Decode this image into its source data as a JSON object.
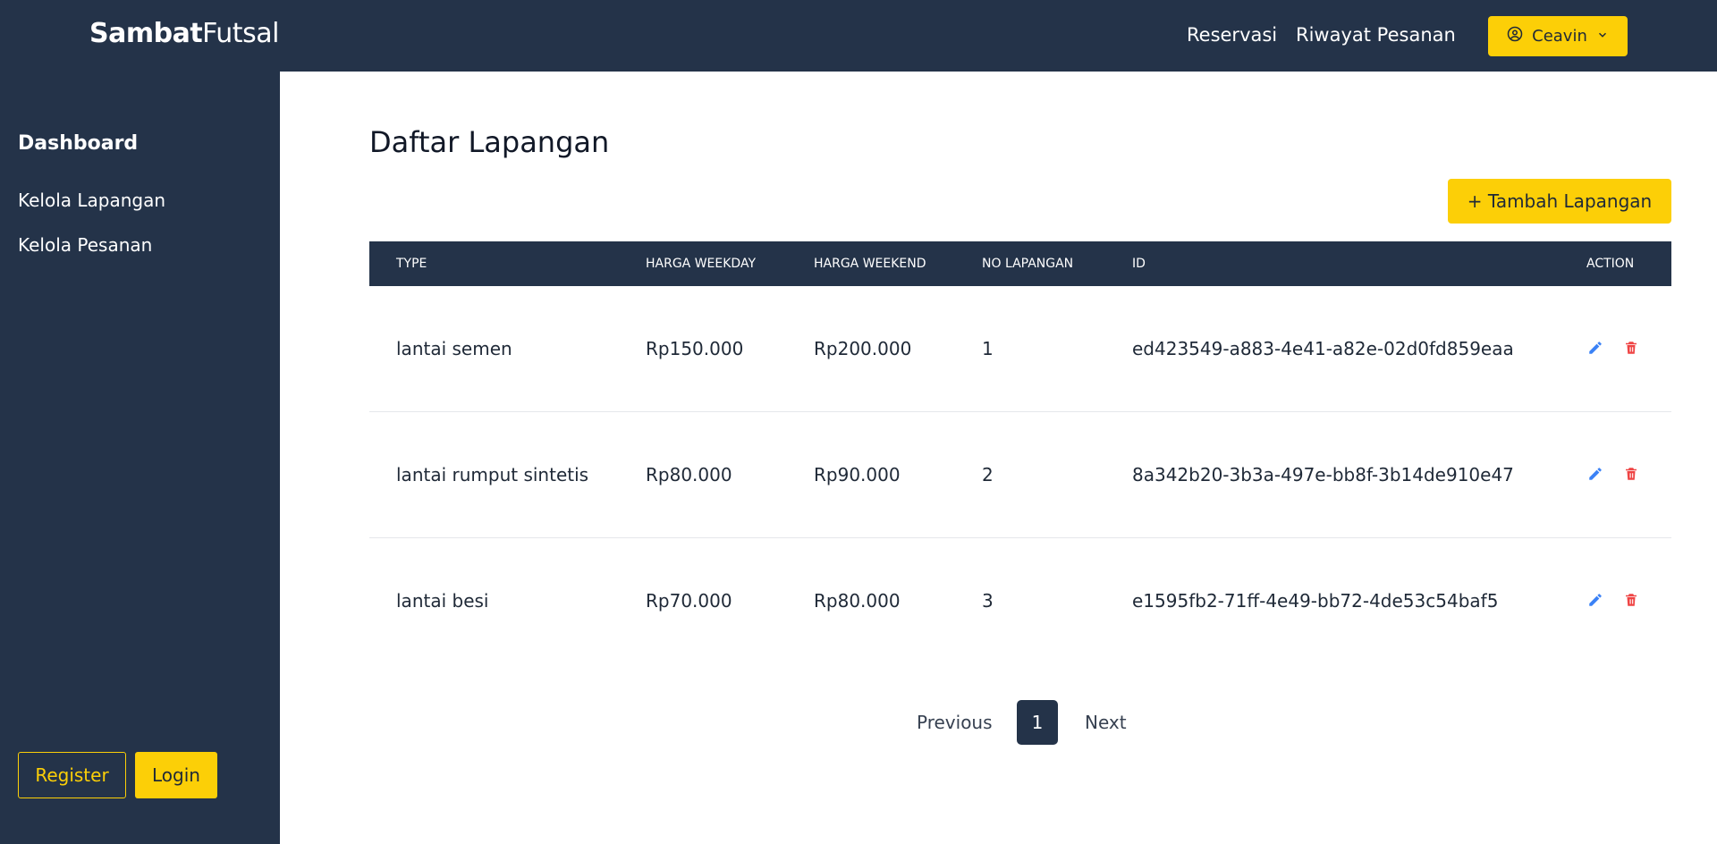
{
  "brand": {
    "bold": "Sambat",
    "light": "Futsal"
  },
  "topnav": {
    "reservasi": "Reservasi",
    "riwayat": "Riwayat Pesanan",
    "user": "Ceavin"
  },
  "sidebar": {
    "title": "Dashboard",
    "items": [
      {
        "label": "Kelola Lapangan"
      },
      {
        "label": "Kelola Pesanan"
      }
    ],
    "register": "Register",
    "login": "Login"
  },
  "main": {
    "title": "Daftar Lapangan",
    "add_button": "+ Tambah Lapangan"
  },
  "table": {
    "headers": [
      "TYPE",
      "HARGA WEEKDAY",
      "HARGA WEEKEND",
      "NO LAPANGAN",
      "ID",
      "ACTION"
    ],
    "rows": [
      {
        "type": "lantai semen",
        "weekday": "Rp150.000",
        "weekend": "Rp200.000",
        "no": "1",
        "id": "ed423549-a883-4e41-a82e-02d0fd859eaa"
      },
      {
        "type": "lantai rumput sintetis",
        "weekday": "Rp80.000",
        "weekend": "Rp90.000",
        "no": "2",
        "id": "8a342b20-3b3a-497e-bb8f-3b14de910e47"
      },
      {
        "type": "lantai besi",
        "weekday": "Rp70.000",
        "weekend": "Rp80.000",
        "no": "3",
        "id": "e1595fb2-71ff-4e49-bb72-4de53c54baf5"
      }
    ]
  },
  "pagination": {
    "previous": "Previous",
    "current": "1",
    "next": "Next"
  },
  "colors": {
    "navy": "#243349",
    "accent": "#fccf07",
    "edit": "#3b82f6",
    "delete": "#ef4444"
  }
}
